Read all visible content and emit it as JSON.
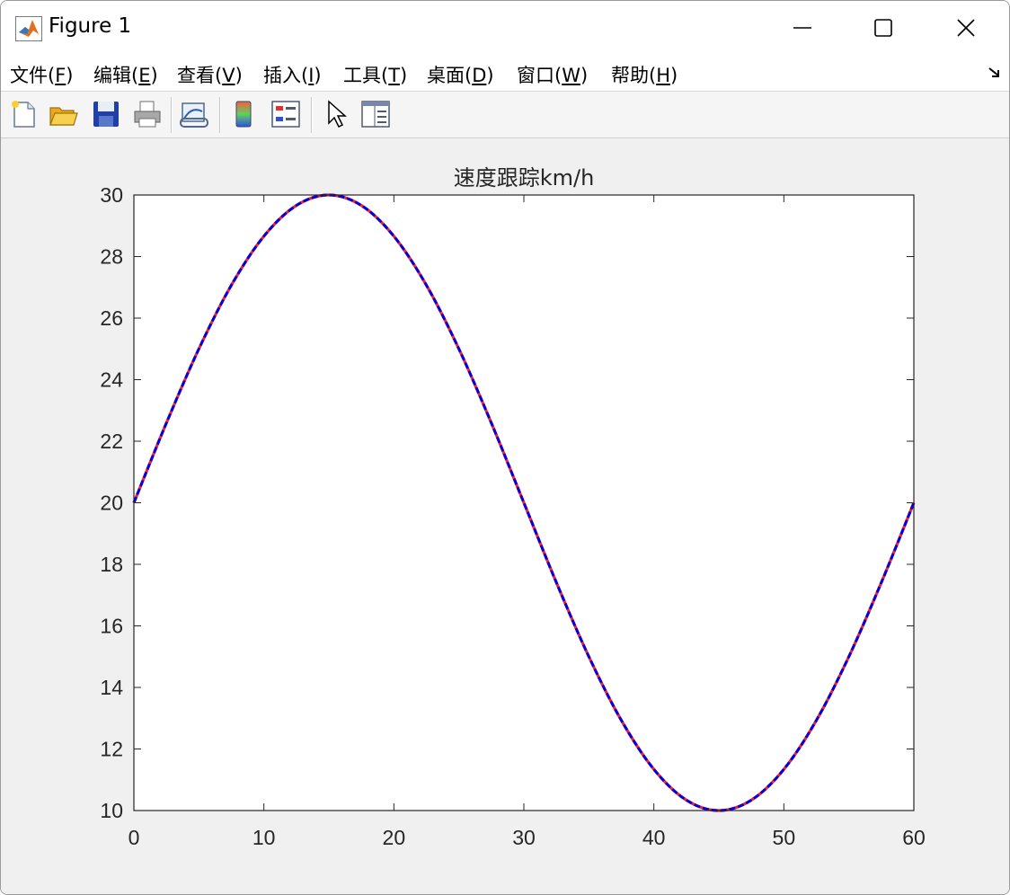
{
  "window": {
    "title": "Figure 1"
  },
  "menu": [
    {
      "label": "文件(",
      "key": "F",
      "end": ")"
    },
    {
      "label": "编辑(",
      "key": "E",
      "end": ")"
    },
    {
      "label": "查看(",
      "key": "V",
      "end": ")"
    },
    {
      "label": "插入(",
      "key": "I",
      "end": ")"
    },
    {
      "label": "工具(",
      "key": "T",
      "end": ")"
    },
    {
      "label": "桌面(",
      "key": "D",
      "end": ")"
    },
    {
      "label": "窗口(",
      "key": "W",
      "end": ")"
    },
    {
      "label": "帮助(",
      "key": "H",
      "end": ")"
    }
  ],
  "toolbar": {
    "icons": [
      "new-figure-icon",
      "open-file-icon",
      "save-icon",
      "print-icon",
      "link-plot-icon",
      "colorbar-icon",
      "legend-icon",
      "pointer-icon",
      "property-inspector-icon"
    ]
  },
  "colors": {
    "series_red": "#ff2020",
    "series_blue": "#0000e0",
    "axes": "#262626"
  },
  "chart_data": {
    "type": "line",
    "title": "速度跟踪km/h",
    "xlim": [
      0,
      60
    ],
    "ylim": [
      10,
      30
    ],
    "xticks": [
      0,
      10,
      20,
      30,
      40,
      50,
      60
    ],
    "yticks": [
      10,
      12,
      14,
      16,
      18,
      20,
      22,
      24,
      26,
      28,
      30
    ],
    "grid": false,
    "series": [
      {
        "style": "dashed-red",
        "x": [
          0,
          2.5,
          5,
          7.5,
          10,
          12.5,
          15,
          17.5,
          20,
          22.5,
          25,
          27.5,
          30,
          32.5,
          35,
          37.5,
          40,
          42.5,
          45,
          47.5,
          50,
          52.5,
          55,
          57.5,
          60
        ],
        "y": [
          20,
          22.59,
          25,
          27.07,
          28.66,
          29.66,
          30,
          29.66,
          28.66,
          27.07,
          25,
          22.59,
          20,
          17.41,
          15,
          12.93,
          11.34,
          10.34,
          10,
          10.34,
          11.34,
          12.93,
          15,
          17.41,
          20
        ]
      },
      {
        "style": "solid-blue",
        "x": [
          0,
          2.5,
          5,
          7.5,
          10,
          12.5,
          15,
          17.5,
          20,
          22.5,
          25,
          27.5,
          30,
          32.5,
          35,
          37.5,
          40,
          42.5,
          45,
          47.5,
          50,
          52.5,
          55,
          57.5,
          60
        ],
        "y": [
          20,
          22.59,
          25,
          27.07,
          28.66,
          29.66,
          30,
          29.66,
          28.66,
          27.07,
          25,
          22.59,
          20,
          17.41,
          15,
          12.93,
          11.34,
          10.34,
          10,
          10.34,
          11.34,
          12.93,
          15,
          17.41,
          20
        ]
      }
    ]
  }
}
